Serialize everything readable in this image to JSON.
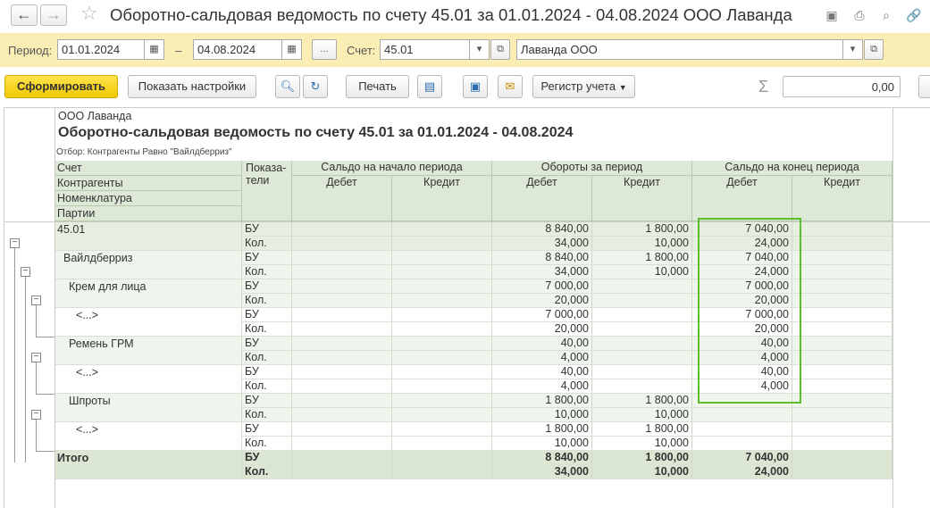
{
  "window": {
    "back_icon": "arrow-left-icon",
    "forward_icon": "arrow-right-icon",
    "title": "Оборотно-сальдовая ведомость по счету 45.01 за 01.01.2024 - 04.08.2024 ООО Лаванда"
  },
  "filters": {
    "period_label": "Период:",
    "date_from": "01.01.2024",
    "dash": "–",
    "date_to": "04.08.2024",
    "ellipsis": "...",
    "account_label": "Счет:",
    "account": "45.01",
    "organization": "Лаванда ООО"
  },
  "toolbar": {
    "generate": "Сформировать",
    "settings": "Показать настройки",
    "print": "Печать",
    "register": "Регистр учета",
    "sum_value": "0,00"
  },
  "report": {
    "company": "ООО Лаванда",
    "title": "Оборотно-сальдовая ведомость по счету 45.01 за 01.01.2024 - 04.08.2024",
    "filter": "Отбор: Контрагенты Равно \"Вайлдберриз\"",
    "headers": {
      "groupings": [
        "Счет",
        "Контрагенты",
        "Номенклатура",
        "Партии"
      ],
      "indicators": "Показа-\nтели",
      "opening": "Сальдо на начало периода",
      "turnover": "Обороты за период",
      "closing": "Сальдо на конец периода",
      "debit": "Дебет",
      "credit": "Кредит"
    },
    "rows": [
      {
        "name": "45.01",
        "level": 1,
        "bu": [
          "",
          "",
          "8 840,00",
          "1 800,00",
          "7 040,00",
          ""
        ],
        "kol": [
          "",
          "",
          "34,000",
          "10,000",
          "24,000",
          ""
        ]
      },
      {
        "name": "Вайлдберриз",
        "level": 2,
        "bu": [
          "",
          "",
          "8 840,00",
          "1 800,00",
          "7 040,00",
          ""
        ],
        "kol": [
          "",
          "",
          "34,000",
          "10,000",
          "24,000",
          ""
        ]
      },
      {
        "name": "Крем для лица",
        "level": 3,
        "bu": [
          "",
          "",
          "7 000,00",
          "",
          "7 000,00",
          ""
        ],
        "kol": [
          "",
          "",
          "20,000",
          "",
          "20,000",
          ""
        ]
      },
      {
        "name": "<...>",
        "level": 4,
        "bu": [
          "",
          "",
          "7 000,00",
          "",
          "7 000,00",
          ""
        ],
        "kol": [
          "",
          "",
          "20,000",
          "",
          "20,000",
          ""
        ]
      },
      {
        "name": "Ремень ГРМ",
        "level": 3,
        "bu": [
          "",
          "",
          "40,00",
          "",
          "40,00",
          ""
        ],
        "kol": [
          "",
          "",
          "4,000",
          "",
          "4,000",
          ""
        ]
      },
      {
        "name": "<...>",
        "level": 4,
        "bu": [
          "",
          "",
          "40,00",
          "",
          "40,00",
          ""
        ],
        "kol": [
          "",
          "",
          "4,000",
          "",
          "4,000",
          ""
        ]
      },
      {
        "name": "Шпроты",
        "level": 3,
        "bu": [
          "",
          "",
          "1 800,00",
          "1 800,00",
          "",
          ""
        ],
        "kol": [
          "",
          "",
          "10,000",
          "10,000",
          "",
          ""
        ]
      },
      {
        "name": "<...>",
        "level": 4,
        "bu": [
          "",
          "",
          "1 800,00",
          "1 800,00",
          "",
          ""
        ],
        "kol": [
          "",
          "",
          "10,000",
          "10,000",
          "",
          ""
        ]
      }
    ],
    "indicator_bu": "БУ",
    "indicator_kol": "Кол.",
    "total": {
      "name": "Итого",
      "bu": [
        "",
        "",
        "8 840,00",
        "1 800,00",
        "7 040,00",
        ""
      ],
      "kol": [
        "",
        "",
        "34,000",
        "10,000",
        "24,000",
        ""
      ]
    }
  }
}
